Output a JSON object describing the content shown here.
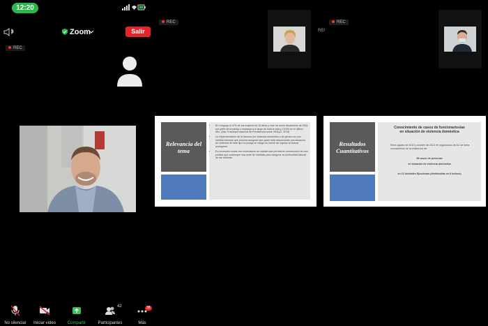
{
  "status_bar": {
    "time": "12:20",
    "icons": "••• ▴ ▮"
  },
  "meeting": {
    "app_name": "Zoom",
    "leave_label": "Salir",
    "rec_label": "REC",
    "rei_label": "REI"
  },
  "toolbar": {
    "items": [
      {
        "label": "No silenciar",
        "icon": "mic-muted-icon"
      },
      {
        "label": "Iniciar video",
        "icon": "video-off-icon"
      },
      {
        "label": "Compartir",
        "icon": "share-icon"
      },
      {
        "label": "Participantes",
        "icon": "participants-icon",
        "count": "42"
      },
      {
        "label": "Más",
        "icon": "more-icon",
        "badge": "38"
      }
    ]
  },
  "slides": [
    {
      "title": "Relevancia del tema",
      "bullets": [
        "En Uruguay el 47% de las mujeres de 15 años y más ha vivido situaciones de VBG por parte de la pareja o expareja a lo largo de toda la vida y 19,5% en el último año. (2da. Encuesta Nacional de Prevalencia sobre VBGyG, 2019)",
        "La implementación de la licencia por violencia doméstica o de género es una medida esencial que procura asegurar que quien está atravesando una situación de violencia de este tipo no ponga en riesgo su fuente de ingreso al buscar protegerse.",
        "Es necesario contar con información de calidad que permita la construcción de una política que contemple una serie de medidas para asegurar la continuidad laboral de las víctimas."
      ]
    },
    {
      "title": "Resultados Cuantitativos",
      "heading_line1": "Conocimiento de casos de funcionarios/as",
      "heading_line2": "en situación de violencia doméstica",
      "bullet": "Entre agosto de 2013 y octubre de 2021 en organismos de AC se toma conocimiento de la existencia de:",
      "highlight_line1": "35 casos de personas",
      "highlight_line2": "en situación de violencia doméstica",
      "footer_line": "en 12 Unidades Ejecutoras (distribuidas en 8 Incisos)"
    }
  ],
  "colors": {
    "zoom_green": "#2bb84a",
    "leave_red": "#e0262c",
    "slide_gray": "#5a5a5a",
    "slide_blue": "#4f7bbd"
  }
}
